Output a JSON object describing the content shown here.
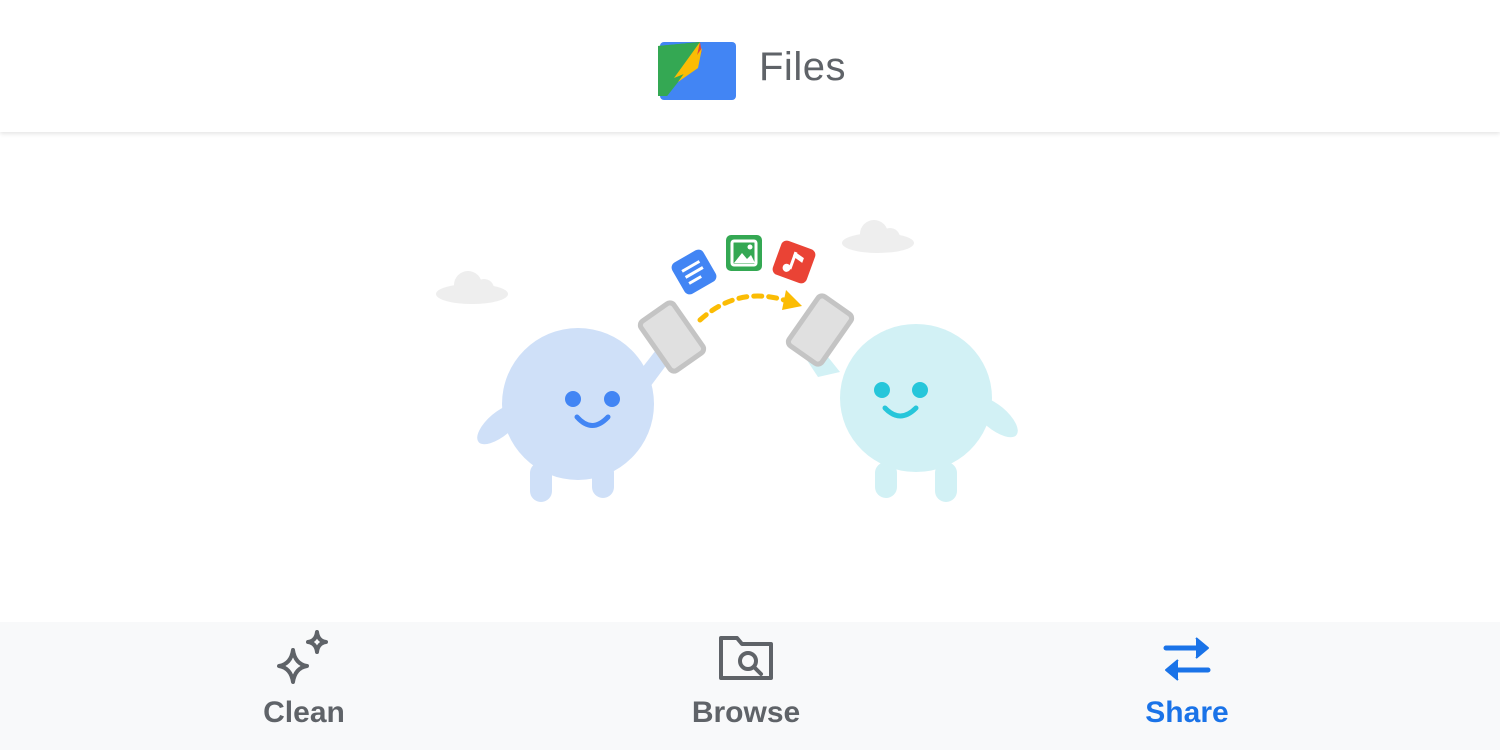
{
  "app": {
    "title": "Files",
    "logo_icon": "files-logo-icon"
  },
  "illustration": {
    "description_icons": [
      "document-icon",
      "image-icon",
      "music-icon"
    ],
    "colors": {
      "left_blob": "#cfe0f8",
      "right_blob": "#d2f1f5",
      "left_face": "#4285f4",
      "right_face": "#26c6da",
      "arrow": "#fbbc04"
    }
  },
  "bottom_nav": {
    "items": [
      {
        "label": "Clean",
        "icon": "sparkle-icon",
        "active": false
      },
      {
        "label": "Browse",
        "icon": "folder-search-icon",
        "active": false
      },
      {
        "label": "Share",
        "icon": "swap-arrows-icon",
        "active": true
      }
    ],
    "colors": {
      "inactive": "#5f6368",
      "active": "#1a73e8"
    }
  }
}
